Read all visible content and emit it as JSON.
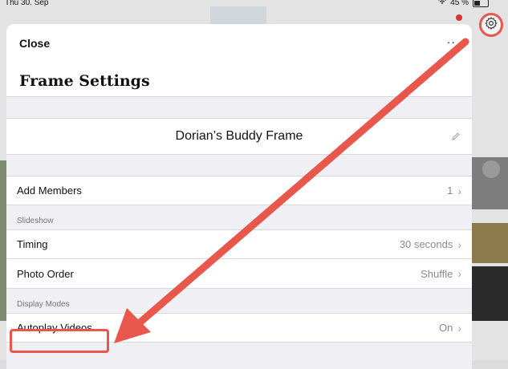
{
  "status_bar": {
    "time": "Thu 30. Sep",
    "battery": "45 %"
  },
  "sheet": {
    "close_label": "Close",
    "more_label": "··",
    "title": "Frame Settings",
    "frame_name": "Dorian’s Buddy Frame"
  },
  "rows": {
    "add_members": {
      "label": "Add Members",
      "value": "1"
    },
    "timing": {
      "label": "Timing",
      "value": "30 seconds"
    },
    "photo_order": {
      "label": "Photo Order",
      "value": "Shuffle"
    },
    "autoplay": {
      "label": "Autoplay Videos",
      "value": "On"
    }
  },
  "sections": {
    "slideshow": "Slideshow",
    "display_modes": "Display Modes"
  },
  "annotation": {
    "color": "#e8564c"
  }
}
